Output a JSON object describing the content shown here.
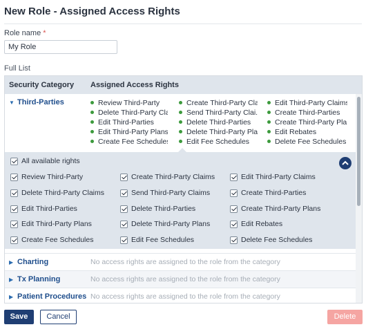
{
  "page": {
    "title": "New Role - Assigned Access Rights"
  },
  "role_name": {
    "label": "Role name",
    "required_mark": "*",
    "value": "My Role"
  },
  "full_list_label": "Full List",
  "grid": {
    "header": {
      "category": "Security Category",
      "rights": "Assigned Access Rights"
    },
    "third_parties": {
      "name": "Third-Parties",
      "assigned_columns": [
        [
          "Review Third-Party",
          "Delete Third-Party Cla...",
          "Edit Third-Parties",
          "Edit Third-Party Plans",
          "Create Fee Schedules"
        ],
        [
          "Create Third-Party Cla...",
          "Send Third-Party Clai...",
          "Delete Third-Parties",
          "Delete Third-Party Pla...",
          "Edit Fee Schedules"
        ],
        [
          "Edit Third-Party Claims",
          "Create Third-Parties",
          "Create Third-Party Pla...",
          "Edit Rebates",
          "Delete Fee Schedules"
        ]
      ],
      "all_available_label": "All available rights",
      "checkbox_columns": [
        [
          "Review Third-Party",
          "Delete Third-Party Claims",
          "Edit Third-Parties",
          "Edit Third-Party Plans",
          "Create Fee Schedules"
        ],
        [
          "Create Third-Party Claims",
          "Send Third-Party Claims",
          "Delete Third-Parties",
          "Delete Third-Party Plans",
          "Edit Fee Schedules"
        ],
        [
          "Edit Third-Party Claims",
          "Create Third-Parties",
          "Create Third-Party Plans",
          "Edit Rebates",
          "Delete Fee Schedules"
        ]
      ]
    },
    "other_categories": [
      {
        "name": "Charting",
        "note": "No access rights are assigned to the role from the category"
      },
      {
        "name": "Tx Planning",
        "note": "No access rights are assigned to the role from the category"
      },
      {
        "name": "Patient Procedures",
        "note": "No access rights are assigned to the role from the category"
      }
    ]
  },
  "buttons": {
    "save": "Save",
    "cancel": "Cancel",
    "delete": "Delete"
  }
}
